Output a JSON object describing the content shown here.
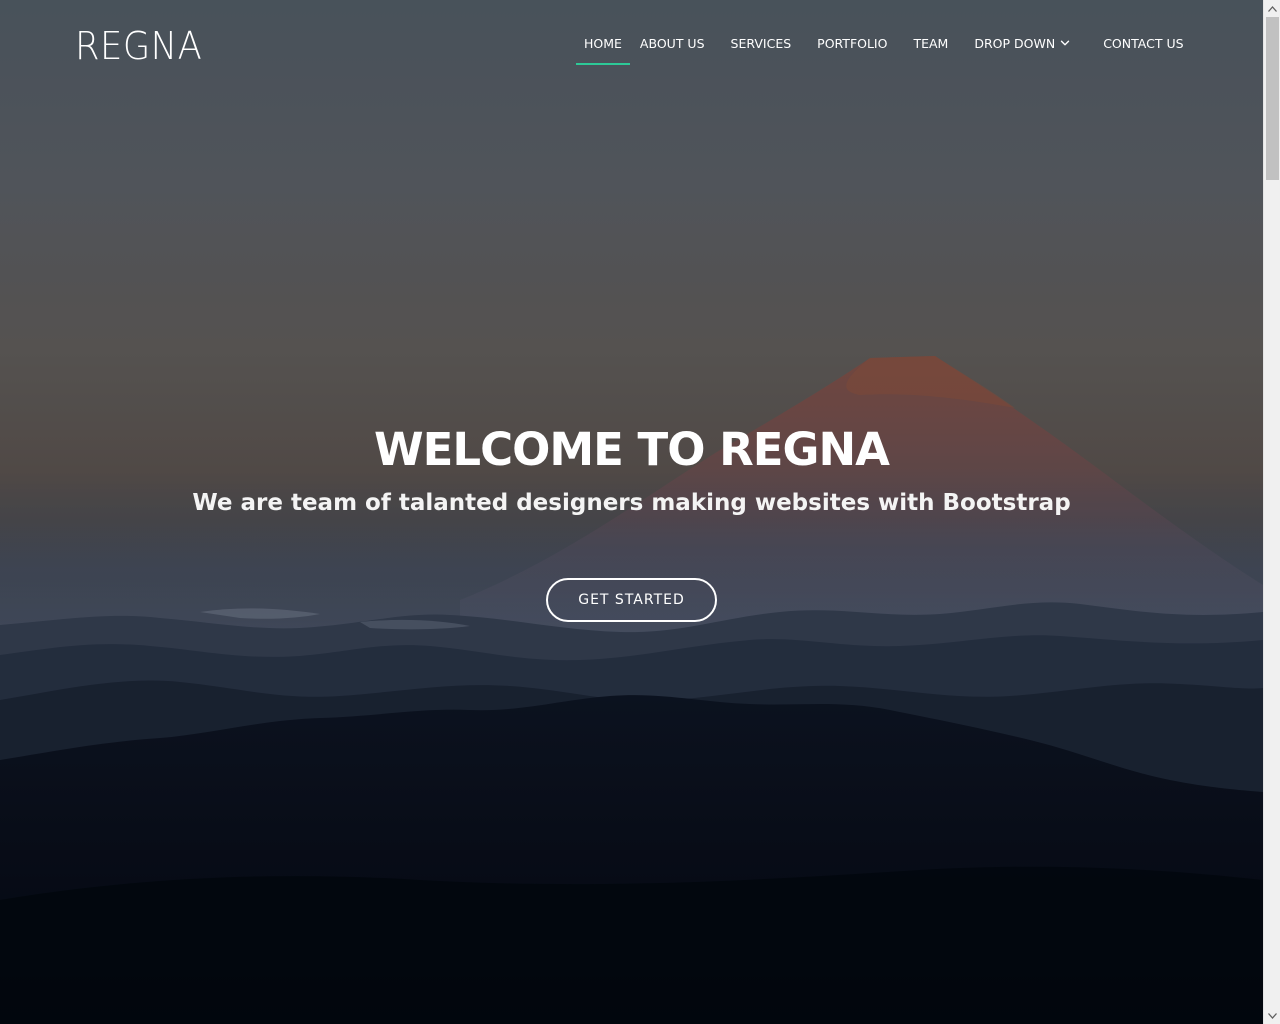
{
  "site": {
    "logo": "REGNA"
  },
  "nav": {
    "items": [
      {
        "label": "Home",
        "active": true
      },
      {
        "label": "About Us"
      },
      {
        "label": "Services"
      },
      {
        "label": "Portfolio"
      },
      {
        "label": "Team"
      },
      {
        "label": "Drop Down",
        "has_dropdown": true
      },
      {
        "label": "Contact Us"
      }
    ]
  },
  "hero": {
    "title": "WELCOME TO REGNA",
    "subtitle": "We are team of talanted designers making websites with Bootstrap",
    "cta_label": "Get Started"
  },
  "theme": {
    "accent": "#2dc997",
    "text": "#ffffff"
  },
  "icons": {
    "dropdown": "chevron-down-icon",
    "scroll_up": "arrow-up-icon",
    "scroll_down": "arrow-down-icon"
  }
}
